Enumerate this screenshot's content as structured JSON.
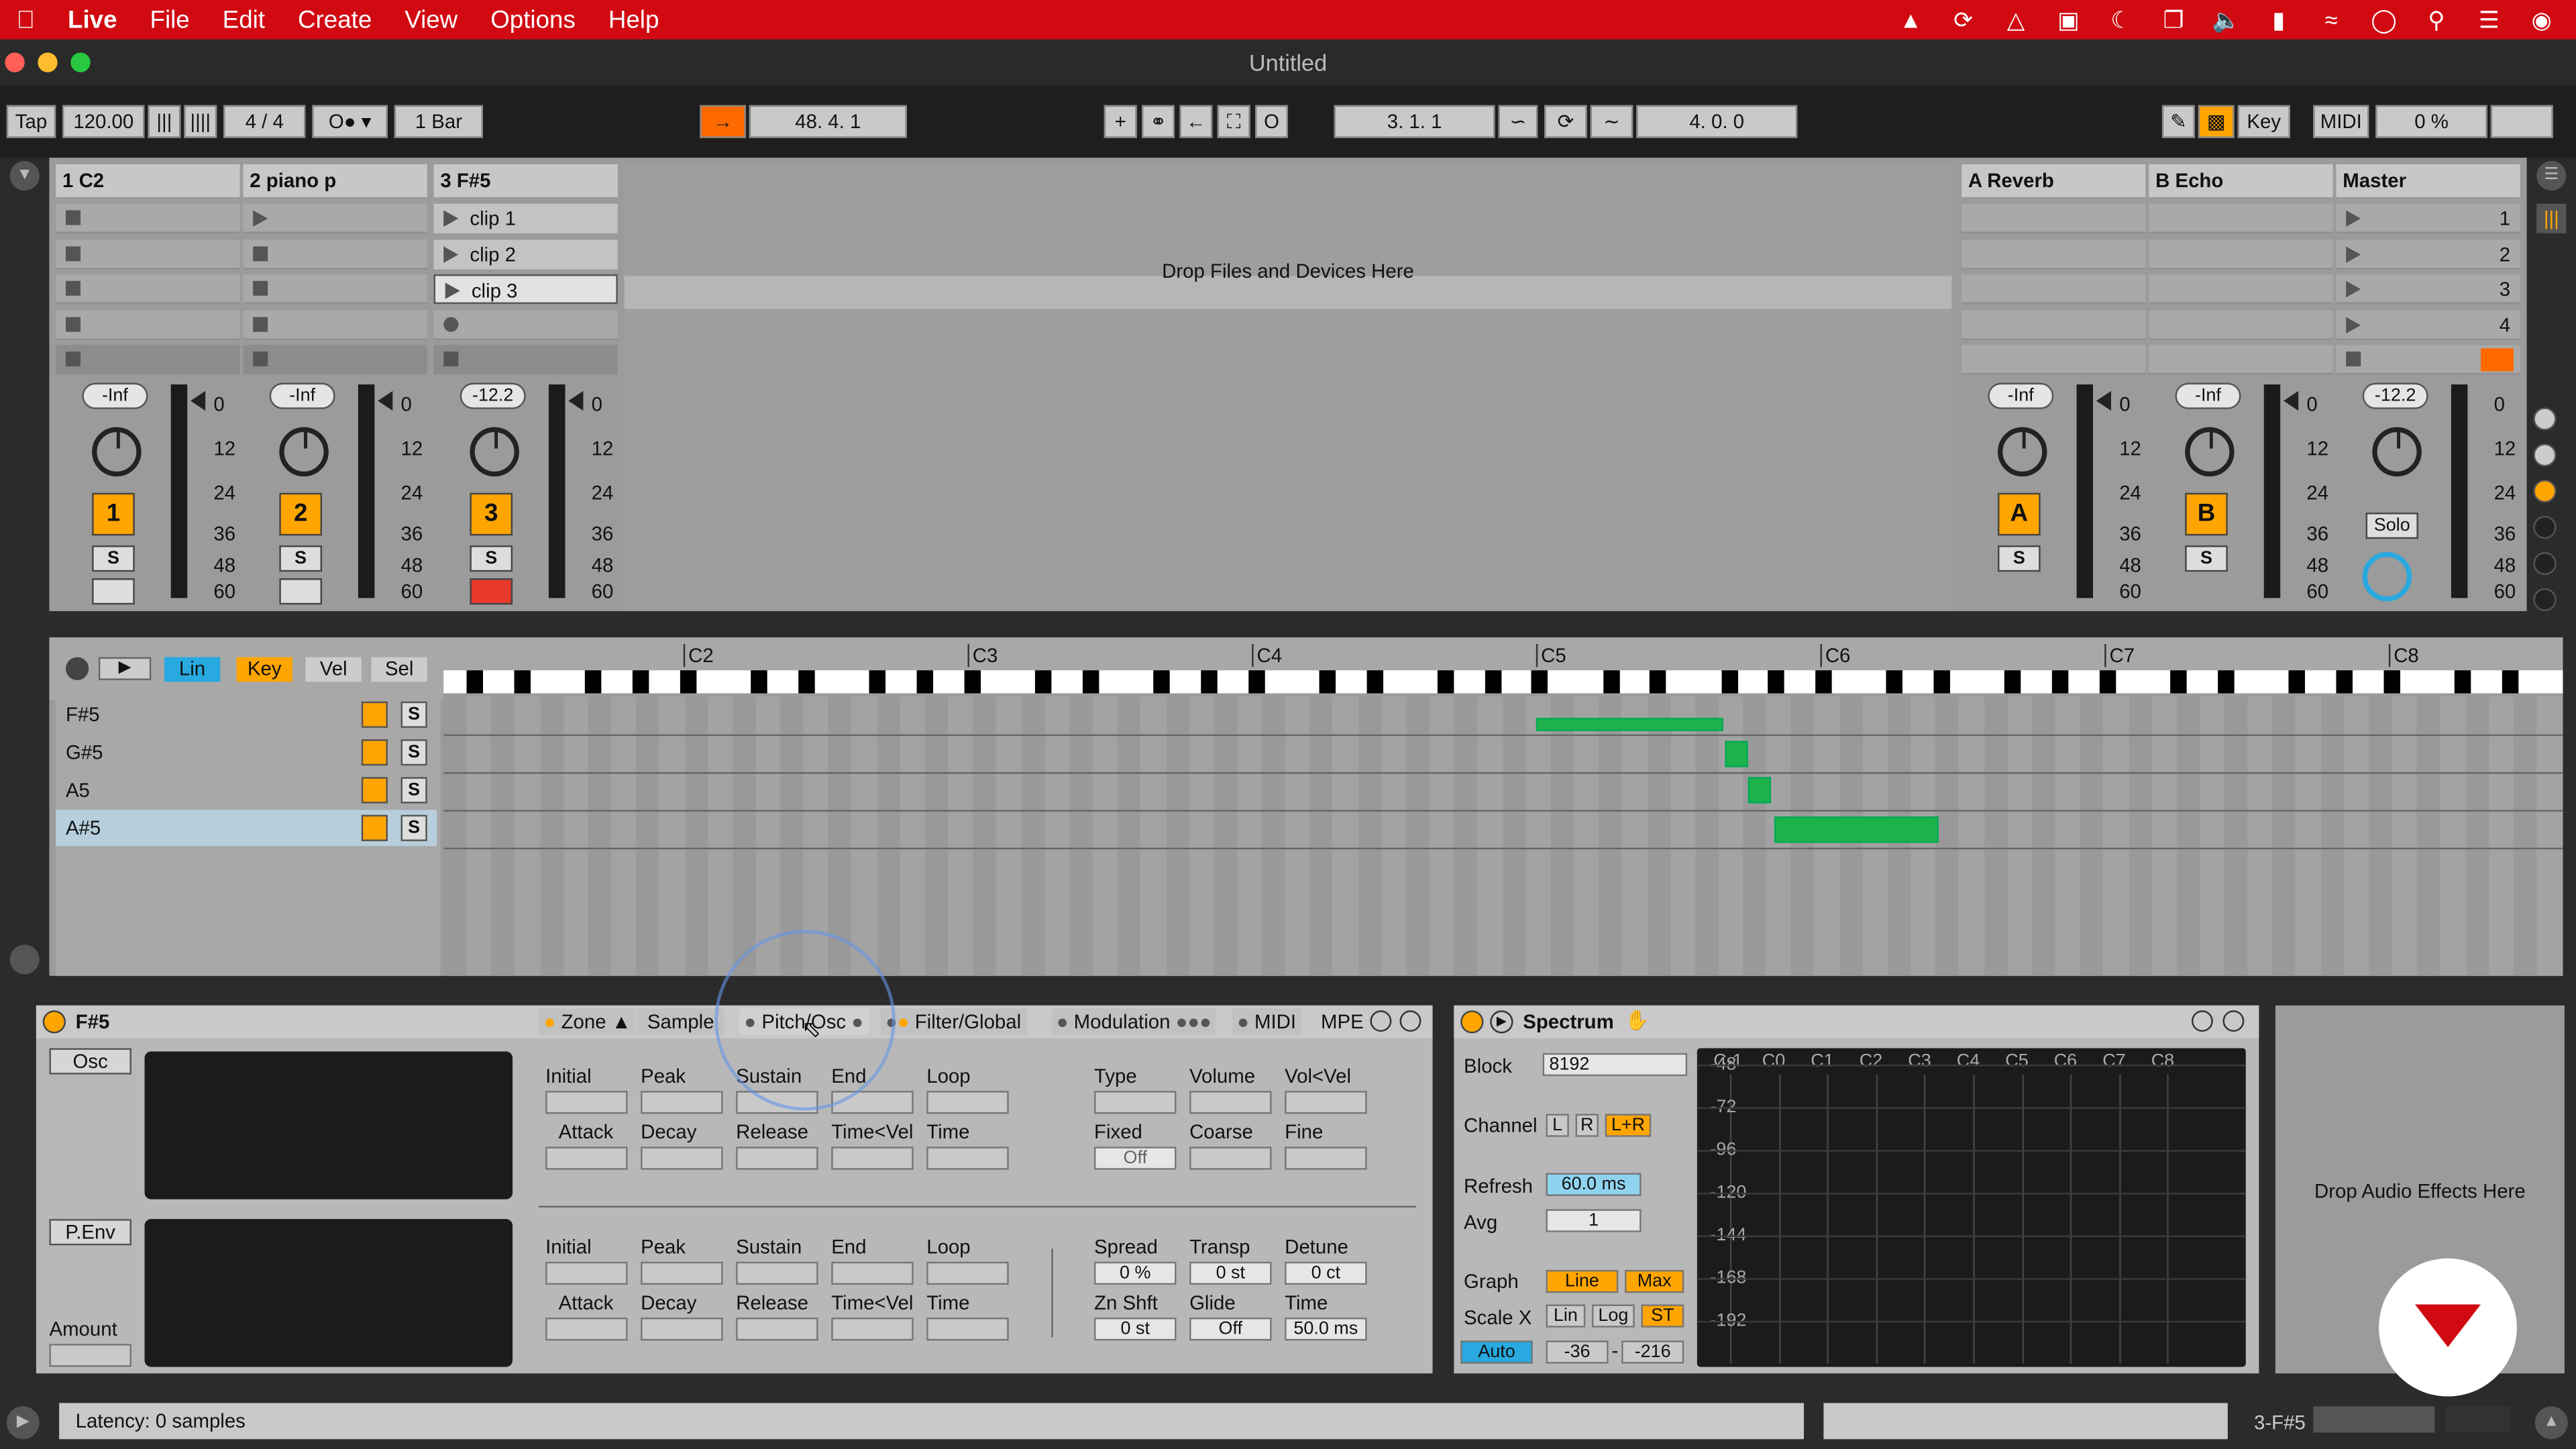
{
  "menubar": {
    "app": "Live",
    "items": [
      "File",
      "Edit",
      "Create",
      "View",
      "Options",
      "Help"
    ]
  },
  "window": {
    "title": "Untitled"
  },
  "control": {
    "tap": "Tap",
    "tempo": "120.00",
    "signature": "4 / 4",
    "quantize": "1 Bar",
    "position": "48.  4.  1",
    "loop_start": "3.  1.  1",
    "loop_length": "4.  0.  0",
    "key": "Key",
    "midi": "MIDI",
    "cpu": "0 %"
  },
  "tracks": [
    {
      "name": "1 C2",
      "volume": "-Inf",
      "number": "1"
    },
    {
      "name": "2 piano p",
      "volume": "-Inf",
      "number": "2"
    },
    {
      "name": "3 F#5",
      "volume": "-12.2",
      "number": "3"
    }
  ],
  "clips": [
    "clip 1",
    "clip 2",
    "clip 3"
  ],
  "returns": [
    {
      "name": "A Reverb",
      "volume": "-Inf",
      "letter": "A"
    },
    {
      "name": "B Echo",
      "volume": "-Inf",
      "letter": "B"
    }
  ],
  "master": {
    "name": "Master",
    "volume": "-12.2",
    "solo": "Solo",
    "scenes": [
      "1",
      "2",
      "3",
      "4"
    ]
  },
  "drop_zone": "Drop Files and Devices Here",
  "meter_scale": [
    "0",
    "12",
    "24",
    "36",
    "48",
    "60"
  ],
  "solo_label": "S",
  "roll": {
    "buttons": [
      "Lin",
      "Key",
      "Vel",
      "Sel"
    ],
    "octaves": [
      "C2",
      "C3",
      "C4",
      "C5",
      "C6",
      "C7",
      "C8"
    ],
    "rows": [
      "F#5",
      "G#5",
      "A5",
      "A#5"
    ]
  },
  "sampler": {
    "title": "F#5",
    "tabs": [
      "Zone",
      "Sample",
      "Pitch/Osc",
      "Filter/Global",
      "Modulation",
      "MIDI",
      "MPE"
    ],
    "osc": "Osc",
    "penv": "P.Env",
    "amount": "Amount",
    "env_labels": [
      "Initial",
      "Peak",
      "Sustain",
      "End",
      "Loop"
    ],
    "env_labels2": [
      "Attack",
      "Decay",
      "Release",
      "Time<Vel",
      "Time"
    ],
    "osc_params": [
      "Type",
      "Volume",
      "Vol<Vel"
    ],
    "osc_params2": [
      "Fixed",
      "Coarse",
      "Fine"
    ],
    "fixed_value": "Off",
    "pitch_params": [
      "Spread",
      "Transp",
      "Detune"
    ],
    "pitch_values": [
      "0 %",
      "0 st",
      "0 ct"
    ],
    "pitch_params2": [
      "Zn Shft",
      "Glide",
      "Time"
    ],
    "pitch_values2": [
      "0 st",
      "Off",
      "50.0 ms"
    ]
  },
  "spectrum": {
    "title": "Spectrum",
    "block_label": "Block",
    "block": "8192",
    "channel_label": "Channel",
    "ch": [
      "L",
      "R",
      "L+R"
    ],
    "refresh_label": "Refresh",
    "refresh": "60.0 ms",
    "avg_label": "Avg",
    "avg": "1",
    "graph_label": "Graph",
    "graph": [
      "Line",
      "Max"
    ],
    "scalex_label": "Scale X",
    "scalex": [
      "Lin",
      "Log",
      "ST"
    ],
    "auto": "Auto",
    "range_lo": "-36",
    "range_hi": "-216",
    "xlabels": [
      "C-1",
      "C0",
      "C1",
      "C2",
      "C3",
      "C4",
      "C5",
      "C6",
      "C7",
      "C8"
    ],
    "ylabels": [
      "-48",
      "-72",
      "-96",
      "-120",
      "-144",
      "-168",
      "-192"
    ]
  },
  "drop_audio": "Drop Audio Effects Here",
  "status": {
    "text": "Latency: 0 samples",
    "track": "3-F#5"
  }
}
